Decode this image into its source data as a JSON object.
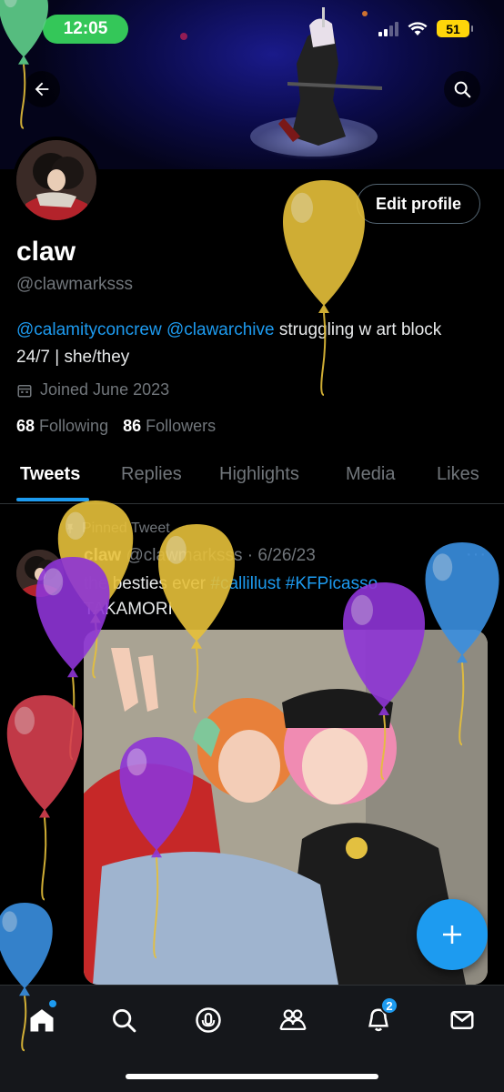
{
  "status_bar": {
    "time": "12:05",
    "battery": "51"
  },
  "profile": {
    "display_name": "claw",
    "handle": "@clawmarksss",
    "bio_mention_1": "@calamityconcrew",
    "bio_mention_2": "@clawarchive",
    "bio_text": " struggling w art block 24/7 | she/they",
    "joined": "Joined June 2023",
    "following_count": "68",
    "following_label": "Following",
    "followers_count": "86",
    "followers_label": "Followers",
    "edit_profile_label": "Edit profile"
  },
  "tabs": [
    {
      "label": "Tweets",
      "active": true
    },
    {
      "label": "Replies"
    },
    {
      "label": "Highlights"
    },
    {
      "label": "Media"
    },
    {
      "label": "Likes"
    }
  ],
  "pinned_tweet": {
    "pinned_label": "Pinned Tweet",
    "name": "claw",
    "handle": "@clawmarksss",
    "separator": " · ",
    "date": "6/26/23",
    "more": "···",
    "text_start": "the besties ever ",
    "tag_1": "#callillust",
    "tag_2": "#KFPicasso",
    "text_end": "TAKAMORI"
  },
  "bottom_nav": {
    "items": [
      "home-icon",
      "search-icon",
      "spaces-icon",
      "communities-icon",
      "notifications-icon",
      "messages-icon"
    ],
    "notifications_badge": "2"
  },
  "colors": {
    "accent": "#1d9bf0",
    "time_pill": "#34c759",
    "battery": "#ffd60a",
    "balloon_yellow": "#e6c03a",
    "balloon_purple": "#8e35d6",
    "balloon_red": "#d6404f",
    "balloon_blue": "#3a8fe0",
    "balloon_green": "#5fd08a"
  }
}
